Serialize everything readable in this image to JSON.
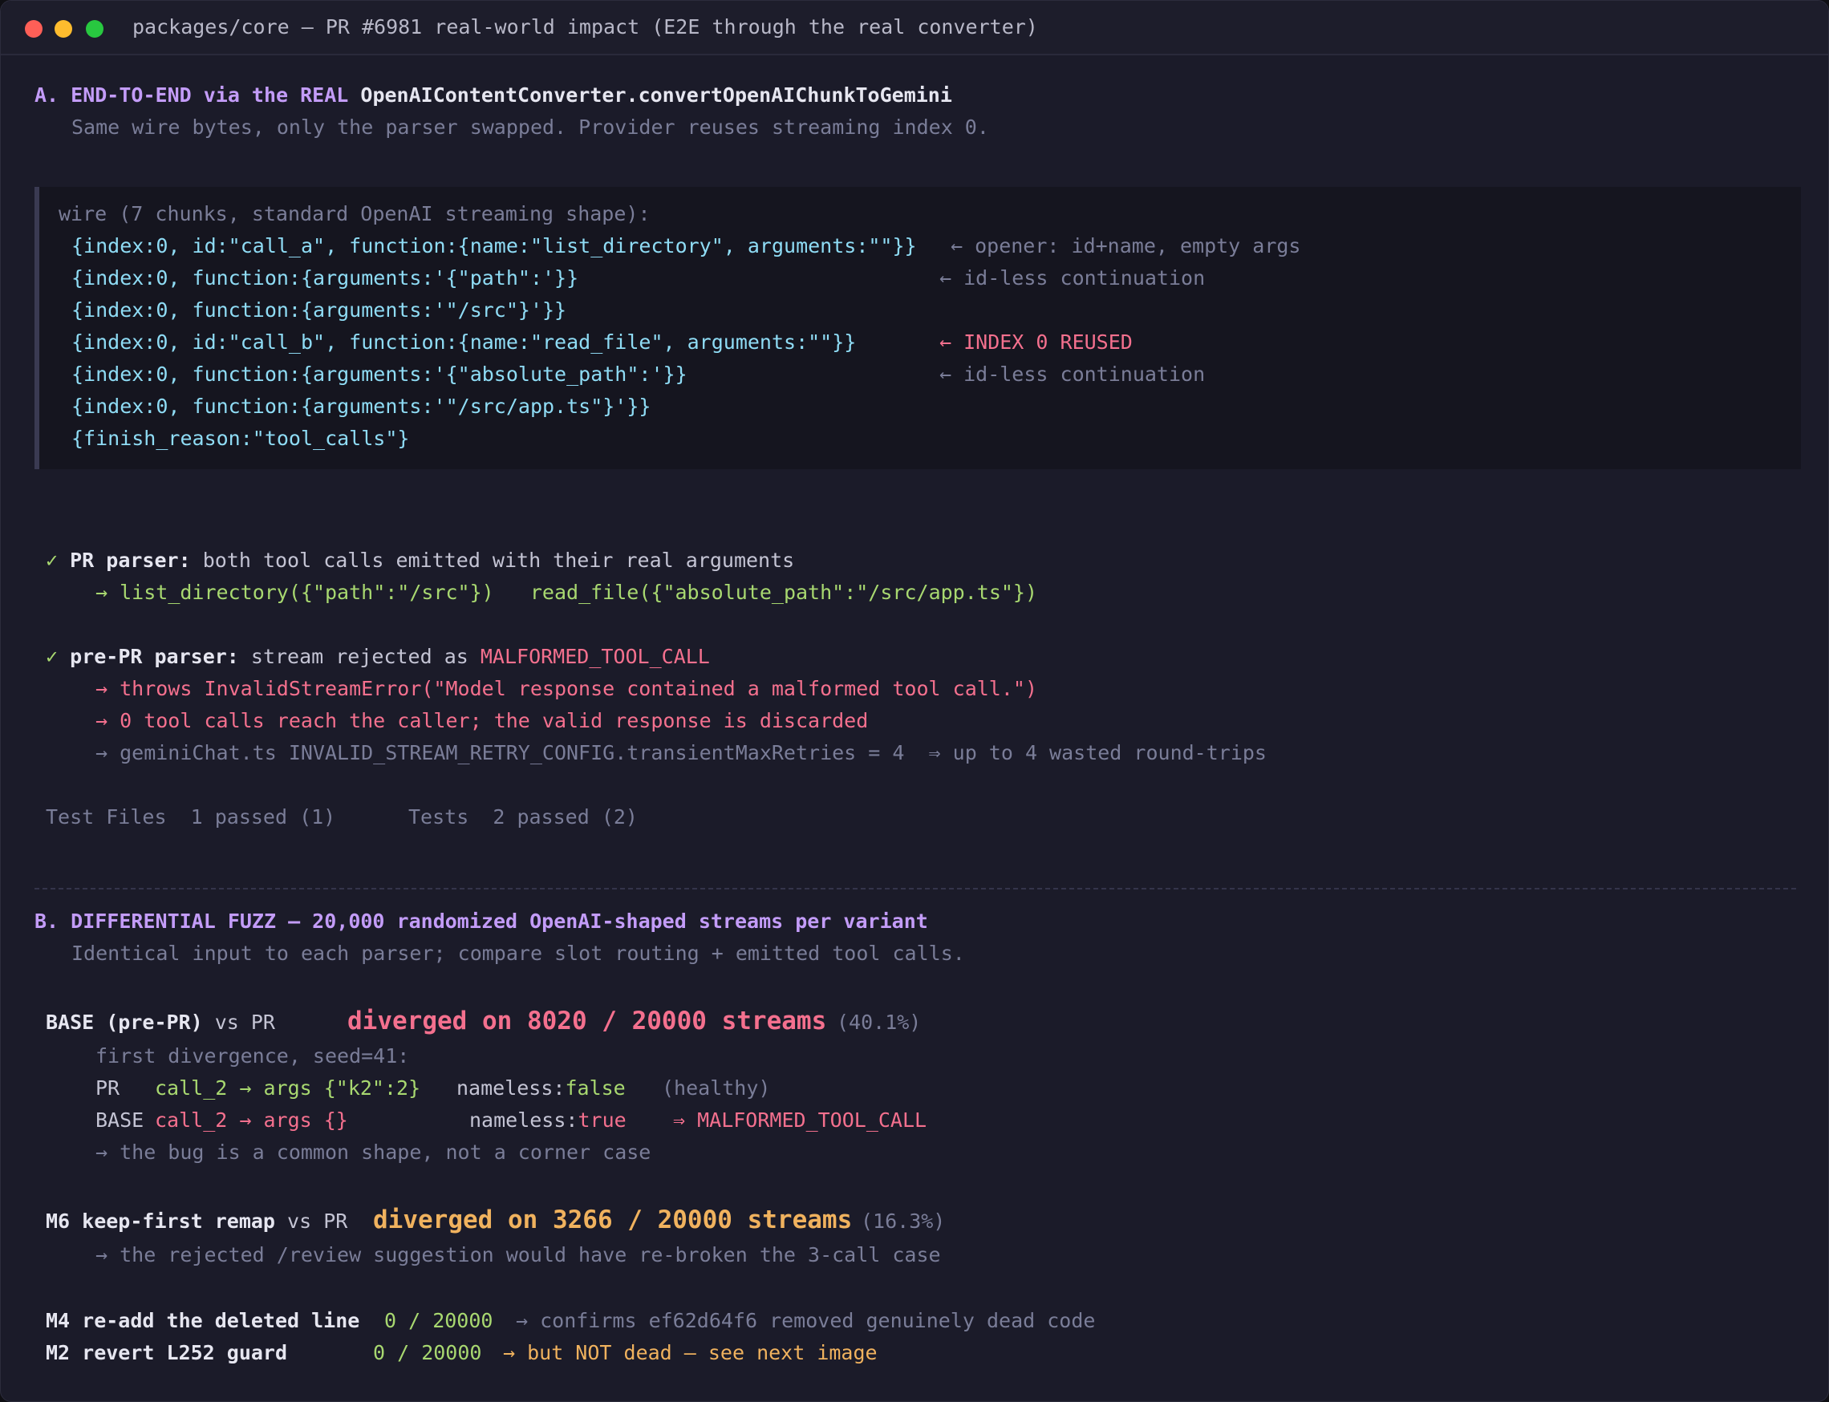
{
  "window": {
    "title": "packages/core — PR #6981 real-world impact (E2E through the real converter)"
  },
  "section_a": {
    "heading_prefix": "A. END-TO-END via the REAL ",
    "heading_target": "OpenAIContentConverter.convertOpenAIChunkToGemini",
    "subtitle": "Same wire bytes, only the parser swapped. Provider reuses streaming index 0.",
    "wire": {
      "header": "wire (7 chunks, standard OpenAI streaming shape):",
      "chunks": [
        "{index:0, id:\"call_a\", function:{name:\"list_directory\", arguments:\"\"}}",
        "{index:0, function:{arguments:'{\"path\":'}}",
        "{index:0, function:{arguments:'\"/src\"}'}}",
        "{index:0, id:\"call_b\", function:{name:\"read_file\", arguments:\"\"}}",
        "{index:0, function:{arguments:'{\"absolute_path\":'}}",
        "{index:0, function:{arguments:'\"/src/app.ts\"}'}}",
        "{finish_reason:\"tool_calls\"}"
      ],
      "notes": {
        "n0": "← opener: id+name, empty args",
        "n1": "← id-less continuation",
        "n3": "← INDEX 0 REUSED",
        "n4": "← id-less continuation"
      }
    },
    "pr_result": {
      "check": "✓",
      "label": "PR parser:",
      "text": " both tool calls emitted with their real arguments",
      "arrow": "→",
      "call1": "list_directory({\"path\":\"/src\"})",
      "call2": "read_file({\"absolute_path\":\"/src/app.ts\"})"
    },
    "prepr_result": {
      "check": "✓",
      "label": "pre-PR parser:",
      "text": " stream rejected as ",
      "code": "MALFORMED_TOOL_CALL",
      "l1": "→ throws InvalidStreamError(\"Model response contained a malformed tool call.\")",
      "l2": "→ 0 tool calls reach the caller; the valid response is discarded",
      "l3": "→ geminiChat.ts INVALID_STREAM_RETRY_CONFIG.transientMaxRetries = 4  ⇒ up to 4 wasted round-trips"
    },
    "summary": {
      "files": "Test Files  1 passed (1)",
      "tests": "Tests  2 passed (2)"
    }
  },
  "section_b": {
    "heading": "B. DIFFERENTIAL FUZZ — 20,000 randomized OpenAI-shaped streams per variant",
    "subtitle": "Identical input to each parser; compare slot routing + emitted tool calls.",
    "base": {
      "label": "BASE (pre-PR)",
      "vs": " vs PR",
      "result": "diverged on 8020 / 20000 streams",
      "pct": "(40.1%)",
      "first": "first divergence, seed=41:",
      "pr_tag": "PR",
      "pr_call": "call_2 → args {\"k2\":2}",
      "pr_nameless_label": "nameless:",
      "pr_nameless_val": "false",
      "pr_note": "(healthy)",
      "base_tag": "BASE",
      "base_call": "call_2 → args {}",
      "base_nameless_label": "nameless:",
      "base_nameless_val": "true",
      "base_note": "⇒ MALFORMED_TOOL_CALL",
      "conclusion": "→ the bug is a common shape, not a corner case"
    },
    "m6": {
      "label": "M6 keep-first remap",
      "vs": " vs PR",
      "result": "diverged on 3266 / 20000 streams",
      "pct": "(16.3%)",
      "note": "→ the rejected /review suggestion would have re-broken the 3-call case"
    },
    "m4": {
      "label": "M4 re-add the deleted line",
      "count": "0 / 20000",
      "note": "→ confirms ef62d64f6 removed genuinely dead code"
    },
    "m2": {
      "label": "M2 revert L252 guard",
      "count": "0 / 20000",
      "note": "→ but NOT dead — see next image"
    }
  }
}
